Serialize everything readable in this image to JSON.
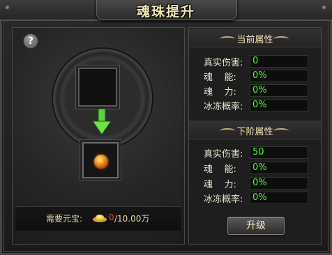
{
  "window": {
    "title": "魂珠提升"
  },
  "left": {
    "help_label": "?",
    "cost": {
      "label": "需要元宝:",
      "have": "0",
      "need": "/10.00万"
    }
  },
  "current_attributes": {
    "title": "当前属性",
    "rows": [
      {
        "label": "真实伤害:",
        "value": "0"
      },
      {
        "label": "魂    能:",
        "value": "0%"
      },
      {
        "label": "魂    力:",
        "value": "0%"
      },
      {
        "label": "冰冻概率:",
        "value": "0%"
      }
    ]
  },
  "next_attributes": {
    "title": "下阶属性",
    "rows": [
      {
        "label": "真实伤害:",
        "value": "50"
      },
      {
        "label": "魂    能:",
        "value": "0%"
      },
      {
        "label": "魂    力:",
        "value": "0%"
      },
      {
        "label": "冰冻概率:",
        "value": "0%"
      }
    ]
  },
  "upgrade_button": {
    "label": "升级"
  },
  "colors": {
    "value_green": "#4cff30",
    "cost_red": "#ff3c2c",
    "title_gold": "#f5e7b5"
  },
  "icons": [
    "help-icon",
    "arrow-down-icon",
    "soul-orb-icon",
    "gold-ingot-icon"
  ]
}
